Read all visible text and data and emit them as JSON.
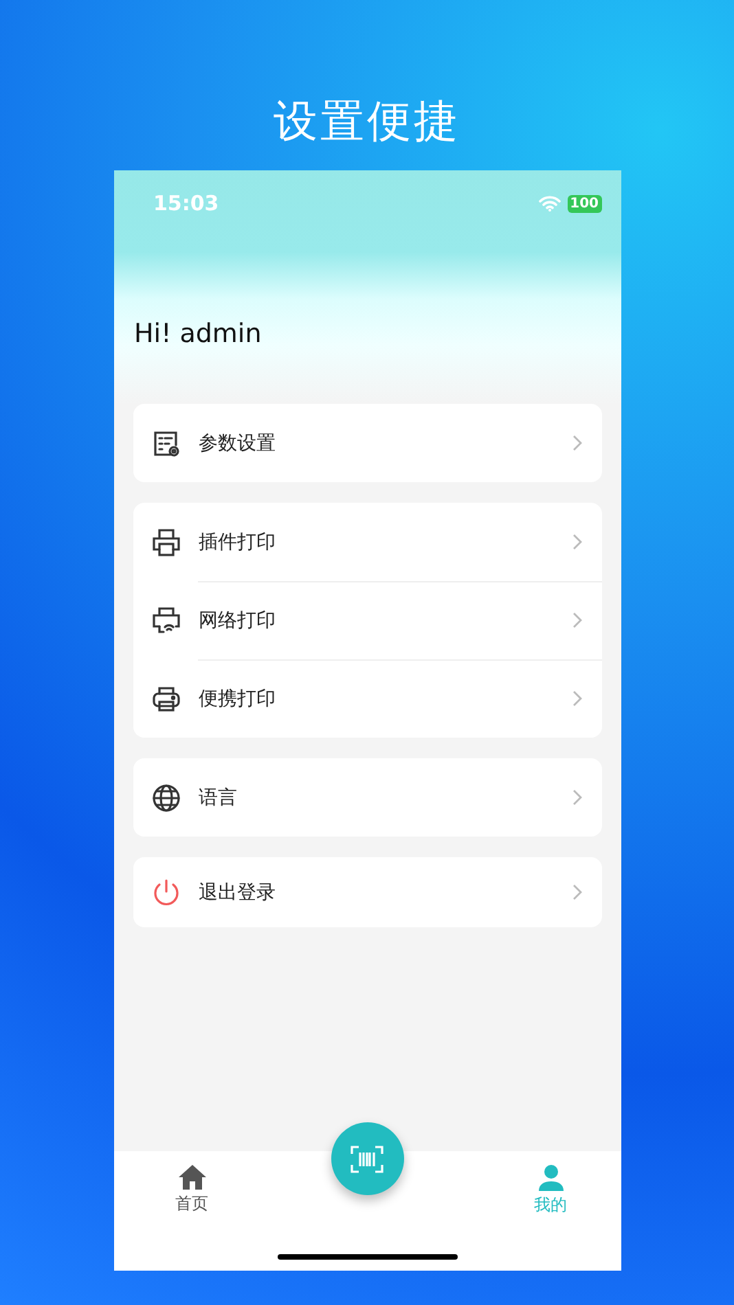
{
  "headline": "设置便捷",
  "status_bar": {
    "time": "15:03",
    "battery": "100"
  },
  "greeting": "Hi! admin",
  "groups": [
    {
      "items": [
        {
          "kind": "settings",
          "label": "参数设置"
        }
      ]
    },
    {
      "items": [
        {
          "kind": "printer",
          "label": "插件打印"
        },
        {
          "kind": "network",
          "label": "网络打印"
        },
        {
          "kind": "portable",
          "label": "便携打印"
        }
      ]
    },
    {
      "items": [
        {
          "kind": "language",
          "label": "语言"
        }
      ]
    },
    {
      "items": [
        {
          "kind": "logout",
          "label": "退出登录"
        }
      ]
    }
  ],
  "tab_bar": [
    {
      "kind": "home",
      "label": "首页",
      "selected": false
    },
    {
      "kind": "profile",
      "label": "我的",
      "selected": true
    }
  ]
}
